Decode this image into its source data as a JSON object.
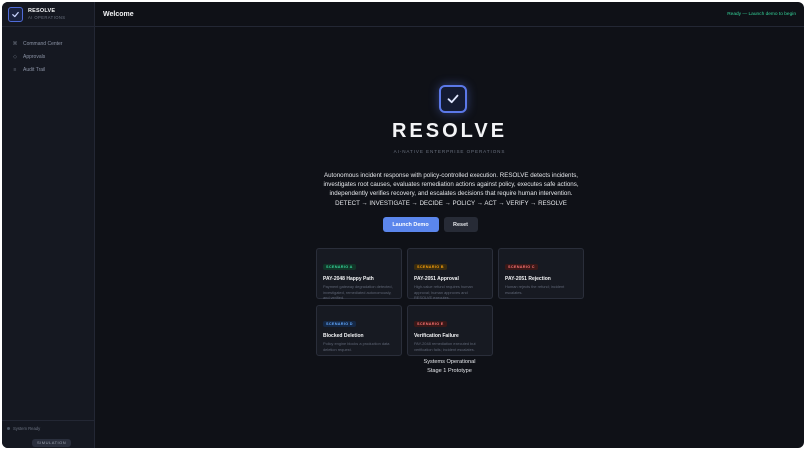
{
  "brand": {
    "name": "RESOLVE",
    "subtitle": "AI OPERATIONS"
  },
  "sidebar": {
    "items": [
      {
        "label": "Command Center",
        "icon": "grid-icon"
      },
      {
        "label": "Approvals",
        "icon": "shield-icon"
      },
      {
        "label": "Audit Trail",
        "icon": "list-icon"
      }
    ],
    "status": "System Ready",
    "mode_badge": "SIMULATION"
  },
  "header": {
    "title": "Welcome",
    "status": "Ready — Launch demo to begin"
  },
  "hero": {
    "title": "RESOLVE",
    "subtitle": "AI-NATIVE ENTERPRISE OPERATIONS",
    "description": "Autonomous incident response with policy-controlled execution. RESOLVE detects incidents, investigates root causes, evaluates remediation actions against policy, executes safe actions, independently verifies recovery, and escalates decisions that require human intervention.",
    "pipeline": "DETECT → INVESTIGATE → DECIDE → POLICY → ACT → VERIFY → RESOLVE"
  },
  "buttons": {
    "launch": "Launch Demo",
    "reset": "Reset"
  },
  "scenarios": [
    {
      "badge": "SCENARIO A",
      "title": "PAY-2048 Happy Path",
      "desc": "Payment gateway degradation detected, investigated, remediated autonomously, and verified.",
      "color": "#34d399",
      "bg": "#123528"
    },
    {
      "badge": "SCENARIO B",
      "title": "PAY-2051 Approval",
      "desc": "High-value refund requires human approval; human approves and RESOLVE executes.",
      "color": "#f59e0b",
      "bg": "#3a2c10"
    },
    {
      "badge": "SCENARIO C",
      "title": "PAY-2051 Rejection",
      "desc": "Human rejects the refund; incident escalates.",
      "color": "#f87171",
      "bg": "#3a1818"
    },
    {
      "badge": "SCENARIO D",
      "title": "Blocked Deletion",
      "desc": "Policy engine blocks a production data deletion request.",
      "color": "#60a5fa",
      "bg": "#152845"
    },
    {
      "badge": "SCENARIO E",
      "title": "Verification Failure",
      "desc": "PAY-2048 remediation executed but verification fails; incident escalates.",
      "color": "#f87171",
      "bg": "#3a1818"
    }
  ],
  "footer": {
    "line1": "Systems Operational",
    "line2": "Stage 1 Prototype"
  }
}
